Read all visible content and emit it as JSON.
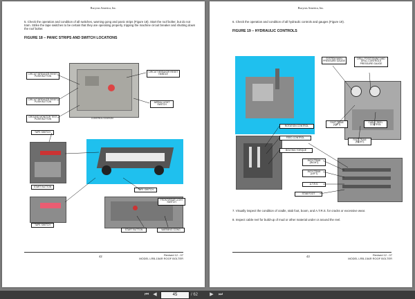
{
  "left_page": {
    "header": "Bucyrus America, Inc.",
    "step5": "5.  Check the operation and condition of all switches, warning gong and panic strips (Figure 18). Start the roof bolter, but do not tram.  Strike the tape switches to be certain that they are operating properly, tripping the machine circuit breaker and shutting down the roof bolter.",
    "figure_title": "FIGURE 18 – PANIC STRIPS AND SWITCH LOCATIONS",
    "callouts": {
      "cb_reset_push": "CIRCUIT BREAKER RESET PUSH BUTTON",
      "cb_reset_handle": "CIRCUIT BREAKER RESET HANDLE",
      "cb_reset_push_2": "CIRCUIT BREAKER RESET PUSH BUTTON",
      "ground_monitor": "GROUND MONITOR TEST PUSH BUTTON",
      "aerial_light": "AERIAL LIGHT SWITCH",
      "control_station": "CONTROL STATION",
      "tape_switch_1": "TAPE SWITCH",
      "start_button_1": "START BUTTON",
      "tape_switch_2": "TAPE SWITCH",
      "tape_switch_3": "TAPE SWITCH",
      "front_rear": "FRONT/REAR LIGHT SWITCH",
      "start_button_2": "START BUTTON",
      "warning_gong": "WARNING GONG"
    },
    "page_number": "42",
    "revised": "Revised 12 - 07",
    "model": "MODEL LRB-15AR ROOF BOLTER"
  },
  "right_page": {
    "header": "Bucyrus America, Inc.",
    "step6": "6.  Check the operation and condition of all hydraulic controls and gauges (Figure 19).",
    "figure_title": "FIGURE 19 – HYDRAULIC CONTROLS",
    "callouts": {
      "system_main": "SYSTEM MAIN PRESSURE GAUGE",
      "drill_positioning": "DRILL POSITIONING AND DRILL CONTROLS PRESSURE GAUGE",
      "fast_tram_left": "FAST TRAM (LEFT)",
      "cable_reel": "CABLE REEL CONTROL",
      "fast_tram_right": "FAST TRAM (RIGHT)",
      "rotation_control": "ROTATION CONTROL",
      "feed_control": "FEED CONTROL",
      "bolting_torque": "BOLTING TORQUE",
      "inch_tram_right": "INCH TRAM (RIGHT)",
      "inch_tram_left": "INCH TRAM (LEFT)",
      "atrs": "A.T.R.S.",
      "stab_foot": "STAB FOOT"
    },
    "step7": "7.  Visually inspect the condition of cradle, stab foot, boom, and A.T.R.S. for cracks or excessive wear.",
    "step8": "8.  Inspect cable reel for build-up of mud or other material under or around the reel.",
    "page_number": "43",
    "revised": "Revised 12 - 07",
    "model": "MODEL LRB-15AR ROOF BOLTER"
  },
  "toolbar": {
    "first_icon": "first-page-icon",
    "prev_icon": "prev-page-icon",
    "next_icon": "next-page-icon",
    "last_icon": "last-page-icon",
    "current_page": "45",
    "page_count": "/ 62",
    "accent": "#3b3b3b"
  },
  "colors": {
    "background": "#7c7c7c",
    "sky_blue": "#1fc0ee",
    "page": "#ffffff"
  }
}
